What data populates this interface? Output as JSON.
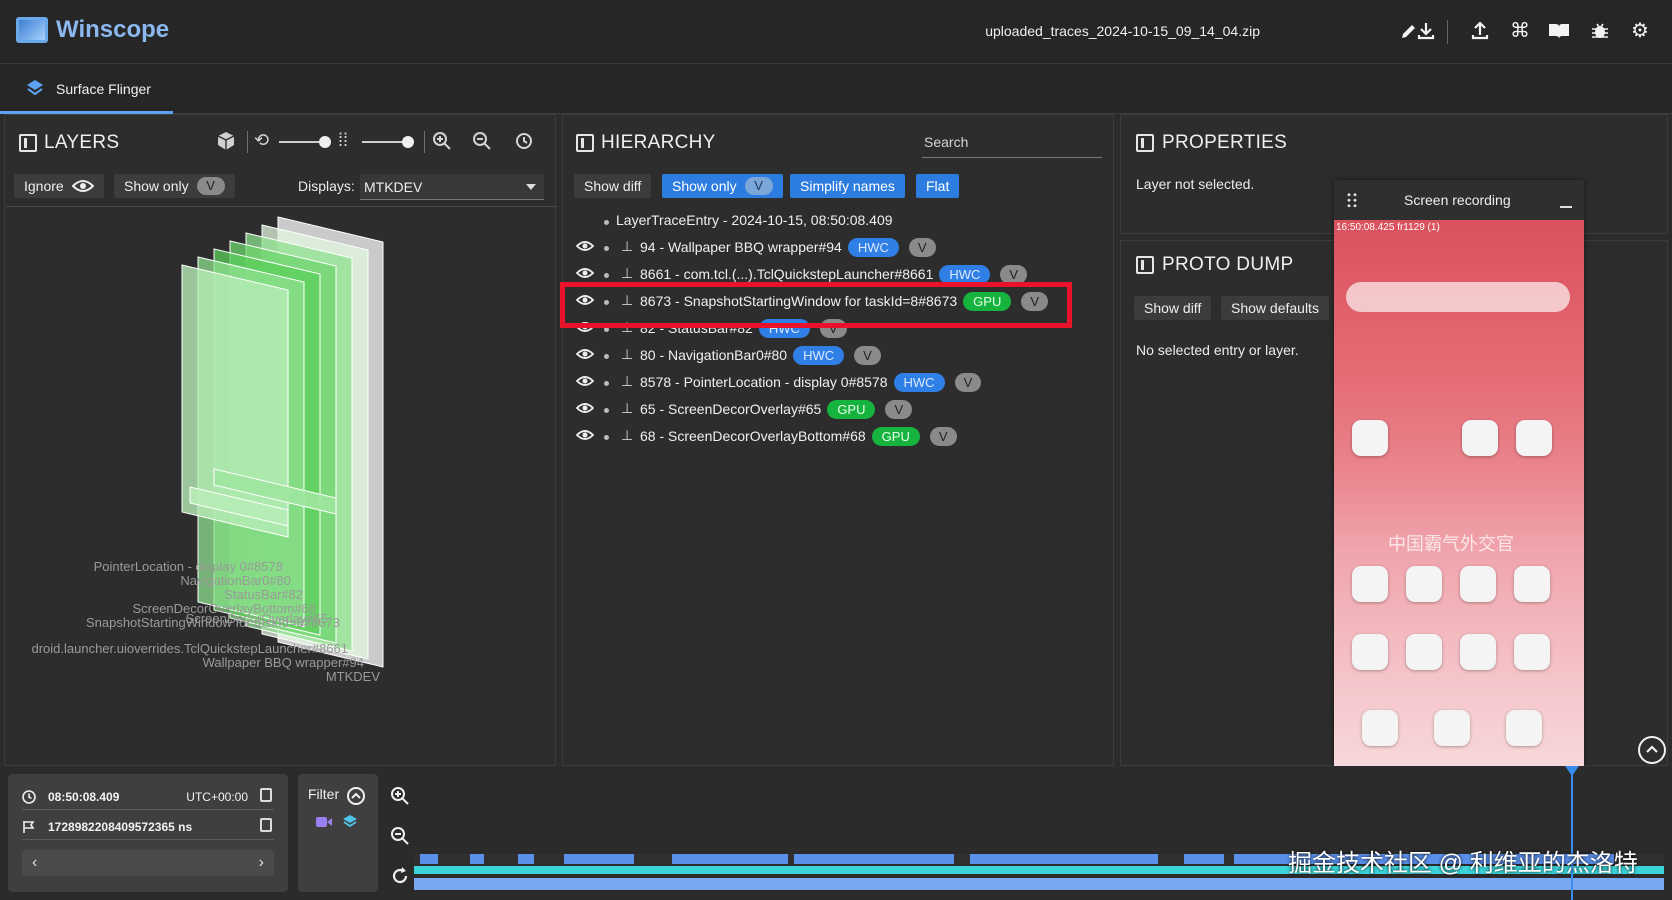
{
  "app": {
    "title": "Winscope",
    "filename": "uploaded_traces_2024-10-15_09_14_04.zip"
  },
  "tabs": [
    {
      "label": "Surface Flinger"
    }
  ],
  "layers": {
    "title": "LAYERS",
    "ignore_label": "Ignore",
    "show_only_label": "Show only",
    "v_label": "V",
    "displays_label": "Displays:",
    "display_value": "MTKDEV",
    "labels": [
      "PointerLocation - display 0#8578",
      "NavigationBar0#80",
      "StatusBar#82",
      "ScreenDecorOverlayBottom#68",
      "SnapshotStartingWindow for taskId=8#8673",
      "ScreenDecorOverlay#65",
      "droid.launcher.uioverrides.TclQuickstepLauncher#8661",
      "Wallpaper BBQ wrapper#94",
      "MTKDEV"
    ]
  },
  "hierarchy": {
    "title": "HIERARCHY",
    "search_placeholder": "Search",
    "show_diff": "Show diff",
    "show_only": "Show only",
    "v_label": "V",
    "simplify_names": "Simplify names",
    "flat": "Flat",
    "root": "LayerTraceEntry - 2024-10-15, 08:50:08.409",
    "rows": [
      {
        "label": "94 - Wallpaper BBQ wrapper#94",
        "badge": "HWC",
        "v": "V"
      },
      {
        "label": "8661 - com.tcl.(...).TclQuickstepLauncher#8661",
        "badge": "HWC",
        "v": "V"
      },
      {
        "label": "8673 - SnapshotStartingWindow for taskId=8#8673",
        "badge": "GPU",
        "v": "V"
      },
      {
        "label": "82 - StatusBar#82",
        "badge": "HWC",
        "v": "V"
      },
      {
        "label": "80 - NavigationBar0#80",
        "badge": "HWC",
        "v": "V"
      },
      {
        "label": "8578 - PointerLocation - display 0#8578",
        "badge": "HWC",
        "v": "V"
      },
      {
        "label": "65 - ScreenDecorOverlay#65",
        "badge": "GPU",
        "v": "V"
      },
      {
        "label": "68 - ScreenDecorOverlayBottom#68",
        "badge": "GPU",
        "v": "V"
      }
    ]
  },
  "properties": {
    "title": "PROPERTIES",
    "empty": "Layer not selected."
  },
  "proto_dump": {
    "title": "PROTO DUMP",
    "show_diff": "Show diff",
    "show_defaults": "Show defaults",
    "empty": "No selected entry or layer."
  },
  "screen_recording": {
    "title": "Screen recording",
    "status_time": "16:50:08.425 fr1129 (1)",
    "headline": "中国霸气外交官"
  },
  "timeline": {
    "time": "08:50:08.409",
    "timezone": "UTC+00:00",
    "ns": "1728982208409572365 ns",
    "filter_label": "Filter",
    "prev": "‹",
    "next": "›"
  },
  "watermark": "掘金技术社区 @ 利维亚的杰洛特",
  "colors": {
    "accent": "#2d7cdf",
    "hwc": "#2f7fe6",
    "gpu": "#16b33f",
    "highlight": "#e8122a"
  }
}
